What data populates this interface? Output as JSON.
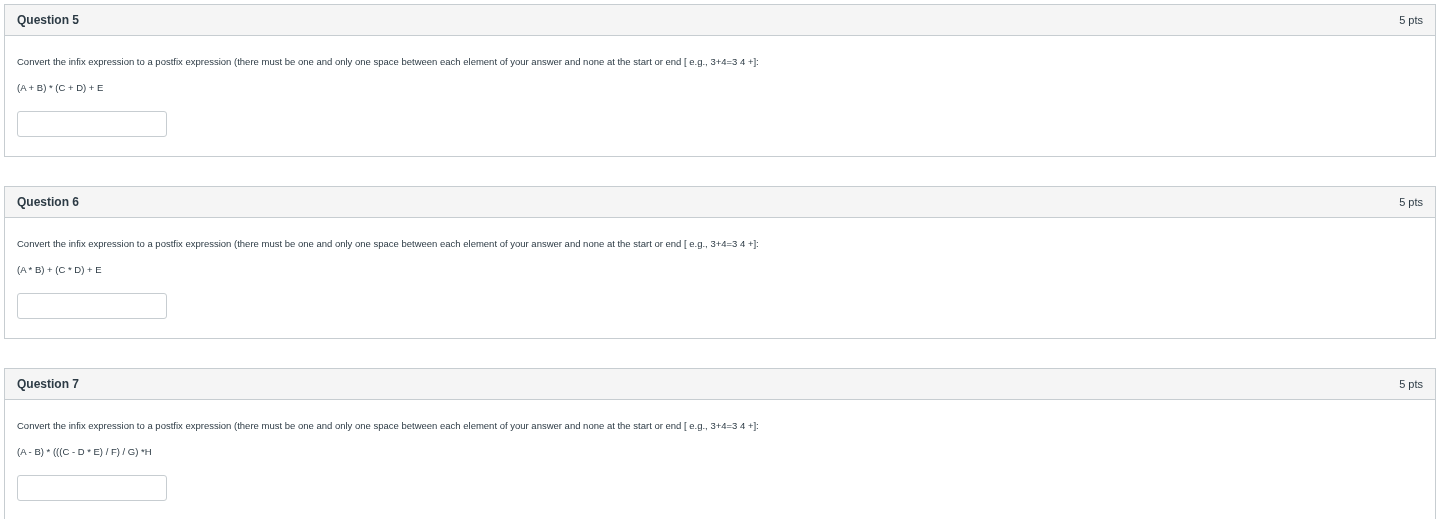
{
  "questions": [
    {
      "title": "Question 5",
      "points": "5 pts",
      "prompt": "Convert the infix expression to a postfix expression (there must be one and only one space between each element of your answer and none at the start or end [ e.g., 3+4=3 4 +]:",
      "expression": "(A + B) * (C + D) + E"
    },
    {
      "title": "Question 6",
      "points": "5 pts",
      "prompt": "Convert the infix expression to a postfix expression (there must be one and only one space between each element of your answer and none at the start or end [ e.g., 3+4=3 4 +]:",
      "expression": "(A * B) + (C * D) + E"
    },
    {
      "title": "Question 7",
      "points": "5 pts",
      "prompt": "Convert the infix expression to a postfix expression (there must be one and only one space between each element of your answer and none at the start or end [ e.g., 3+4=3 4 +]:",
      "expression": "(A - B) * (((C - D * E) / F) / G) *H"
    }
  ]
}
